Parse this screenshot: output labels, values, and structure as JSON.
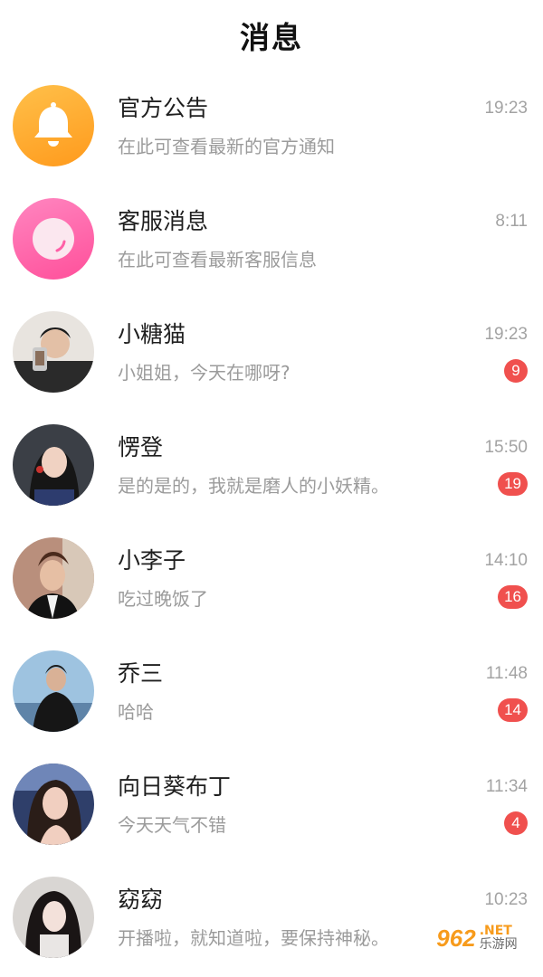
{
  "header": {
    "title": "消息"
  },
  "conversations": [
    {
      "name": "官方公告",
      "message": "在此可查看最新的官方通知",
      "time": "19:23",
      "badge": null,
      "avatar": "bell-icon"
    },
    {
      "name": "客服消息",
      "message": "在此可查看最新客服信息",
      "time": "8:11",
      "badge": null,
      "avatar": "customer-service-icon"
    },
    {
      "name": "小糖猫",
      "message": "小姐姐，今天在哪呀?",
      "time": "19:23",
      "badge": "9",
      "avatar": "user-photo"
    },
    {
      "name": "愣登",
      "message": "是的是的，我就是磨人的小妖精。",
      "time": "15:50",
      "badge": "19",
      "avatar": "user-photo"
    },
    {
      "name": "小李子",
      "message": "吃过晚饭了",
      "time": "14:10",
      "badge": "16",
      "avatar": "user-photo"
    },
    {
      "name": "乔三",
      "message": "哈哈",
      "time": "11:48",
      "badge": "14",
      "avatar": "user-photo"
    },
    {
      "name": "向日葵布丁",
      "message": "今天天气不错",
      "time": "11:34",
      "badge": "4",
      "avatar": "user-photo"
    },
    {
      "name": "窈窈",
      "message": "开播啦，就知道啦，要保持神秘。",
      "time": "10:23",
      "badge": null,
      "avatar": "user-photo"
    }
  ],
  "watermark": {
    "number": "962",
    "suffix": ".NET",
    "site": "乐游网"
  },
  "colors": {
    "badge": "#f0504e",
    "bell": "#ffae2e",
    "service": "#ff5fa6"
  }
}
